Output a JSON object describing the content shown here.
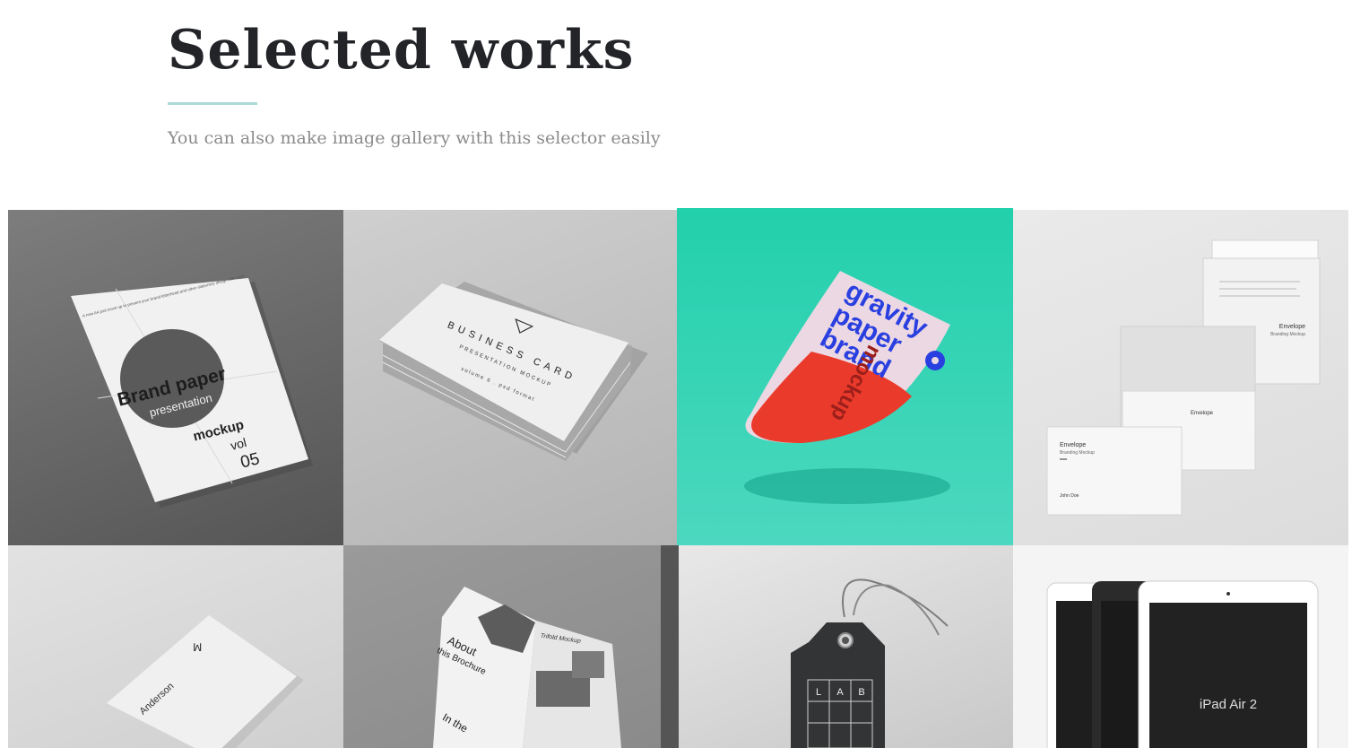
{
  "header": {
    "title": "Selected works",
    "subtitle": "You can also make image gallery with this selector easily",
    "accent_color": "#a9d8d8"
  },
  "gallery": {
    "items": [
      {
        "mockup": "brand-paper-presentation",
        "lines": [
          "Brand paper",
          "presentation",
          "mockup",
          "vol",
          "05"
        ],
        "fine_print": "A new A4 psd mock up to present your brand letterhead and other stationery design with style"
      },
      {
        "mockup": "business-card",
        "lines": [
          "BUSINESS CARD",
          "PRESENTATION MOCKUP",
          "volume 6 . psd format"
        ]
      },
      {
        "mockup": "gravity-paper-brand",
        "lines": [
          "gravity",
          "paper",
          "brand",
          "mockup"
        ],
        "colors": {
          "background": "#22d0ac",
          "text": "#2a3fe0",
          "accent": "#ea3a2b"
        }
      },
      {
        "mockup": "envelope-branding",
        "lines": [
          "Envelope",
          "Branding Mockup",
          "John Doe"
        ]
      },
      {
        "mockup": "business-card-anderson",
        "lines": [
          "Anderson"
        ]
      },
      {
        "mockup": "trifold-brochure",
        "lines": [
          "About",
          "this Brochure",
          "Trifold Mockup",
          "In the"
        ]
      },
      {
        "mockup": "lab-hang-tag",
        "lines": [
          "L",
          "A",
          "B"
        ]
      },
      {
        "mockup": "ipad-air-2",
        "lines": [
          "iPad Air 2"
        ]
      }
    ]
  }
}
